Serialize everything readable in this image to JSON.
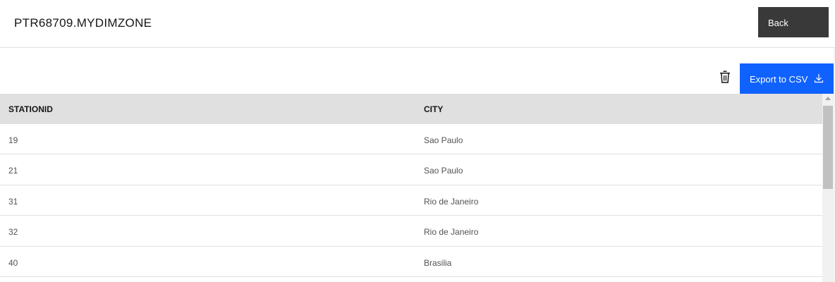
{
  "header": {
    "title": "PTR68709.MYDIMZONE",
    "back_label": "Back"
  },
  "toolbar": {
    "delete_icon": "trash-icon",
    "export_label": "Export to CSV",
    "export_icon": "download-icon",
    "accent_color": "#0f62fe"
  },
  "table": {
    "columns": [
      "STATIONID",
      "CITY"
    ],
    "rows": [
      [
        "19",
        "Sao Paulo"
      ],
      [
        "21",
        "Sao Paulo"
      ],
      [
        "31",
        "Rio de Janeiro"
      ],
      [
        "32",
        "Rio de Janeiro"
      ],
      [
        "40",
        "Brasilia"
      ]
    ]
  }
}
